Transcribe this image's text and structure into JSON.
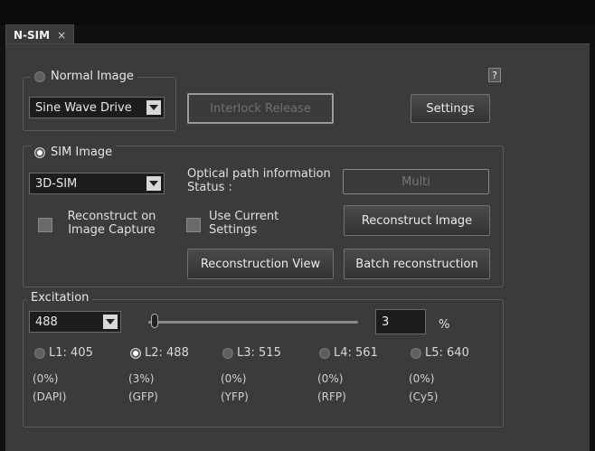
{
  "tab": {
    "title": "N-SIM",
    "close": "×"
  },
  "normal_image": {
    "label": "Normal Image",
    "drive_select": "Sine Wave Drive",
    "interlock_button": "Interlock Release",
    "settings_button": "Settings",
    "help": "?"
  },
  "sim_image": {
    "label": "SIM Image",
    "mode_select": "3D-SIM",
    "optical_status_label": "Optical path information Status :",
    "optical_status_value": "Multi",
    "reconstruct_capture_label": "Reconstruct on Image Capture",
    "use_current_label": "Use Current Settings",
    "reconstruct_image_button": "Reconstruct Image",
    "reconstruction_view_button": "Reconstruction View",
    "batch_button": "Batch reconstruction"
  },
  "excitation": {
    "label": "Excitation",
    "wavelength_select": "488",
    "power_value": "3",
    "power_unit": "%",
    "slider_fraction": 0.03,
    "lasers": [
      {
        "label": "L1: 405",
        "selected": false,
        "percent": "(0%)",
        "dye": "(DAPI)"
      },
      {
        "label": "L2: 488",
        "selected": true,
        "percent": "(3%)",
        "dye": "(GFP)"
      },
      {
        "label": "L3: 515",
        "selected": false,
        "percent": "(0%)",
        "dye": "(YFP)"
      },
      {
        "label": "L4: 561",
        "selected": false,
        "percent": "(0%)",
        "dye": "(RFP)"
      },
      {
        "label": "L5: 640",
        "selected": false,
        "percent": "(0%)",
        "dye": "(Cy5)"
      }
    ]
  }
}
